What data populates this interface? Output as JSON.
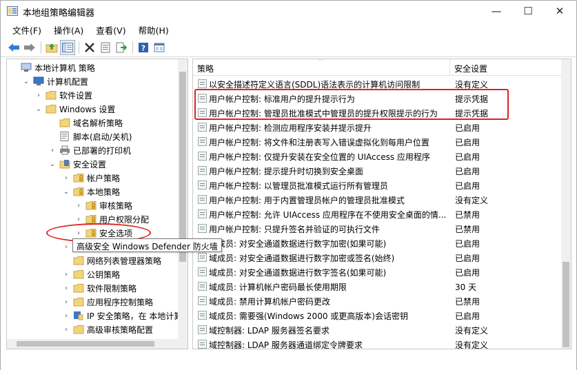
{
  "window": {
    "title": "本地组策略编辑器",
    "minimize_glyph": "—",
    "maximize_glyph": "☐",
    "close_glyph": "✕"
  },
  "menu": [
    "文件(F)",
    "操作(A)",
    "查看(V)",
    "帮助(H)"
  ],
  "toolbar": {
    "icons": [
      "back-icon",
      "forward-icon",
      "up-folder-icon",
      "show-hide-tree-icon",
      "delete-icon",
      "properties-icon",
      "export-list-icon",
      "help-icon",
      "view-icon"
    ]
  },
  "tree": [
    {
      "label": "本地计算机 策略",
      "expander": "",
      "icon": "policy"
    },
    {
      "label": "计算机配置",
      "expander": "⌄",
      "icon": "computer"
    },
    {
      "label": "软件设置",
      "expander": "›",
      "icon": "folder"
    },
    {
      "label": "Windows 设置",
      "expander": "⌄",
      "icon": "folder"
    },
    {
      "label": "域名解析策略",
      "expander": "",
      "icon": "folder"
    },
    {
      "label": "脚本(启动/关机)",
      "expander": "",
      "icon": "script"
    },
    {
      "label": "已部署的打印机",
      "expander": "›",
      "icon": "printer"
    },
    {
      "label": "安全设置",
      "expander": "⌄",
      "icon": "shield"
    },
    {
      "label": "帐户策略",
      "expander": "›",
      "icon": "folder-lock"
    },
    {
      "label": "本地策略",
      "expander": "⌄",
      "icon": "folder-lock"
    },
    {
      "label": "审核策略",
      "expander": "›",
      "icon": "folder-lock"
    },
    {
      "label": "用户权限分配",
      "expander": "›",
      "icon": "folder-lock"
    },
    {
      "label": "安全选项",
      "expander": "›",
      "icon": "folder-lock"
    },
    {
      "label": "高级安全 Windows Defender 防火墙",
      "expander": "›",
      "icon": "folder"
    },
    {
      "label": "网络列表管理器策略",
      "expander": "",
      "icon": "folder"
    },
    {
      "label": "公钥策略",
      "expander": "›",
      "icon": "folder"
    },
    {
      "label": "软件限制策略",
      "expander": "›",
      "icon": "folder"
    },
    {
      "label": "应用程序控制策略",
      "expander": "›",
      "icon": "folder"
    },
    {
      "label": "IP 安全策略，在 本地计算机",
      "expander": "›",
      "icon": "ipsec"
    },
    {
      "label": "高级审核策略配置",
      "expander": "›",
      "icon": "folder"
    }
  ],
  "tooltip": "高级安全 Windows Defender 防火墙",
  "list": {
    "col_policy": "策略",
    "col_setting": "安全设置",
    "sort_glyph": "^",
    "rows": [
      {
        "name": "以安全描述符定义语言(SDDL)语法表示的计算机访问限制",
        "value": "没有定义"
      },
      {
        "name": "用户帐户控制: 标准用户的提升提示行为",
        "value": "提示凭据"
      },
      {
        "name": "用户帐户控制: 管理员批准模式中管理员的提升权限提示的行为",
        "value": "提示凭据"
      },
      {
        "name": "用户帐户控制: 检测应用程序安装并提示提升",
        "value": "已启用"
      },
      {
        "name": "用户帐户控制: 将文件和注册表写入错误虚拟化到每用户位置",
        "value": "已启用"
      },
      {
        "name": "用户帐户控制: 仅提升安装在安全位置的 UIAccess 应用程序",
        "value": "已启用"
      },
      {
        "name": "用户帐户控制: 提示提升时切换到安全桌面",
        "value": "已启用"
      },
      {
        "name": "用户帐户控制: 以管理员批准模式运行所有管理员",
        "value": "已启用"
      },
      {
        "name": "用户帐户控制: 用于内置管理员帐户的管理员批准模式",
        "value": "没有定义"
      },
      {
        "name": "用户帐户控制: 允许 UIAccess 应用程序在不使用安全桌面的情...",
        "value": "已禁用"
      },
      {
        "name": "用户帐户控制: 只提升签名并验证的可执行文件",
        "value": "已禁用"
      },
      {
        "name": "域成员: 对安全通道数据进行数字加密(如果可能)",
        "value": "已启用"
      },
      {
        "name": "域成员: 对安全通道数据进行数字加密或签名(始终)",
        "value": "已启用"
      },
      {
        "name": "域成员: 对安全通道数据进行数字签名(如果可能)",
        "value": "已启用"
      },
      {
        "name": "域成员: 计算机帐户密码最长使用期限",
        "value": "30 天"
      },
      {
        "name": "域成员: 禁用计算机帐户密码更改",
        "value": "已禁用"
      },
      {
        "name": "域成员: 需要强(Windows 2000 或更高版本)会话密钥",
        "value": "已启用"
      },
      {
        "name": "域控制器: LDAP 服务器签名要求",
        "value": "没有定义"
      },
      {
        "name": "域控制器: LDAP 服务器通道绑定令牌要求",
        "value": "没有定义"
      }
    ]
  },
  "annotation_color": "#e02020"
}
